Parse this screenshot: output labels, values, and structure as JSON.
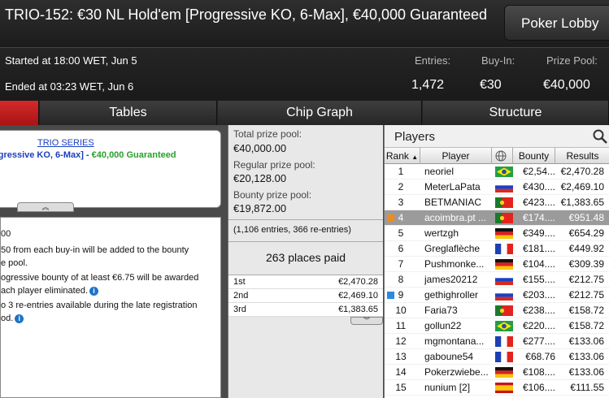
{
  "header": {
    "title": "TRIO-152: €30 NL Hold'em [Progressive KO, 6-Max], €40,000 Guaranteed",
    "lobby_button": "Poker Lobby"
  },
  "info": {
    "started": "Started at 18:00 WET, Jun 5",
    "ended": "Ended at 03:23 WET, Jun 6",
    "entries_label": "Entries:",
    "entries_value": "1,472",
    "buyin_label": "Buy-In:",
    "buyin_value": "€30",
    "prizepool_label": "Prize Pool:",
    "prizepool_value": "€40,000"
  },
  "tabs": [
    {
      "label": ""
    },
    {
      "label": "Tables"
    },
    {
      "label": "Chip Graph"
    },
    {
      "label": "Structure"
    }
  ],
  "series": {
    "link": "TRIO SERIES",
    "name": "ogressive KO, 6-Max]",
    "sep": " - ",
    "guarantee": "€40,000 Guaranteed",
    "collapse": "︽"
  },
  "rules": [
    "00",
    "50 from each buy-in will be added to the bounty",
    "e pool.",
    "ogressive bounty of at least €6.75 will be awarded",
    "ach player eliminated.",
    "o 3 re-entries available during the late registration",
    "od."
  ],
  "prize": {
    "total_label": "Total prize pool:",
    "total_value": "€40,000.00",
    "regular_label": "Regular prize pool:",
    "regular_value": "€20,128.00",
    "bounty_label": "Bounty prize pool:",
    "bounty_value": "€19,872.00",
    "entries_note": "(1,106 entries, 366 re-entries)",
    "places_paid": "263 places paid",
    "rows": [
      {
        "place": "1st",
        "amount": "€2,470.28"
      },
      {
        "place": "2nd",
        "amount": "€2,469.10"
      },
      {
        "place": "3rd",
        "amount": "€1,383.65"
      }
    ],
    "expand": "︾"
  },
  "players": {
    "title": "Players",
    "columns": {
      "rank": "Rank",
      "player": "Player",
      "bounty": "Bounty",
      "results": "Results"
    },
    "rows": [
      {
        "rank": "1",
        "name": "neoriel",
        "flag": "brazil",
        "bounty": "€2,54...",
        "result": "€2,470.28"
      },
      {
        "rank": "2",
        "name": "MeterLaPata",
        "flag": "russia",
        "bounty": "€430....",
        "result": "€2,469.10"
      },
      {
        "rank": "3",
        "name": "BETMANIAC",
        "flag": "portugal",
        "bounty": "€423....",
        "result": "€1,383.65"
      },
      {
        "rank": "4",
        "name": "acoimbra.pt ...",
        "flag": "portugal",
        "bounty": "€174....",
        "result": "€951.48"
      },
      {
        "rank": "5",
        "name": "wertzgh",
        "flag": "germany",
        "bounty": "€349....",
        "result": "€654.29"
      },
      {
        "rank": "6",
        "name": "Greglaflèche",
        "flag": "france",
        "bounty": "€181....",
        "result": "€449.92"
      },
      {
        "rank": "7",
        "name": "Pushmonke...",
        "flag": "germany",
        "bounty": "€104....",
        "result": "€309.39"
      },
      {
        "rank": "8",
        "name": "james20212",
        "flag": "russia",
        "bounty": "€155....",
        "result": "€212.75"
      },
      {
        "rank": "9",
        "name": "gethighroller",
        "flag": "russia",
        "bounty": "€203....",
        "result": "€212.75"
      },
      {
        "rank": "10",
        "name": "Faria73",
        "flag": "portugal",
        "bounty": "€238....",
        "result": "€158.72"
      },
      {
        "rank": "11",
        "name": "gollun22",
        "flag": "brazil",
        "bounty": "€220....",
        "result": "€158.72"
      },
      {
        "rank": "12",
        "name": "mgmontana...",
        "flag": "france",
        "bounty": "€277....",
        "result": "€133.06"
      },
      {
        "rank": "13",
        "name": "gaboune54",
        "flag": "france",
        "bounty": "€68.76",
        "result": "€133.06"
      },
      {
        "rank": "14",
        "name": "Pokerzwiebe...",
        "flag": "germany",
        "bounty": "€108....",
        "result": "€133.06"
      },
      {
        "rank": "15",
        "name": "nunium [2]",
        "flag": "spain",
        "bounty": "€106....",
        "result": "€111.55"
      }
    ]
  },
  "colors": {
    "accent": "#c41e1e",
    "selected_row": "#9b9b9b",
    "link": "#1a3fbd",
    "guarantee": "#2aa02a"
  }
}
